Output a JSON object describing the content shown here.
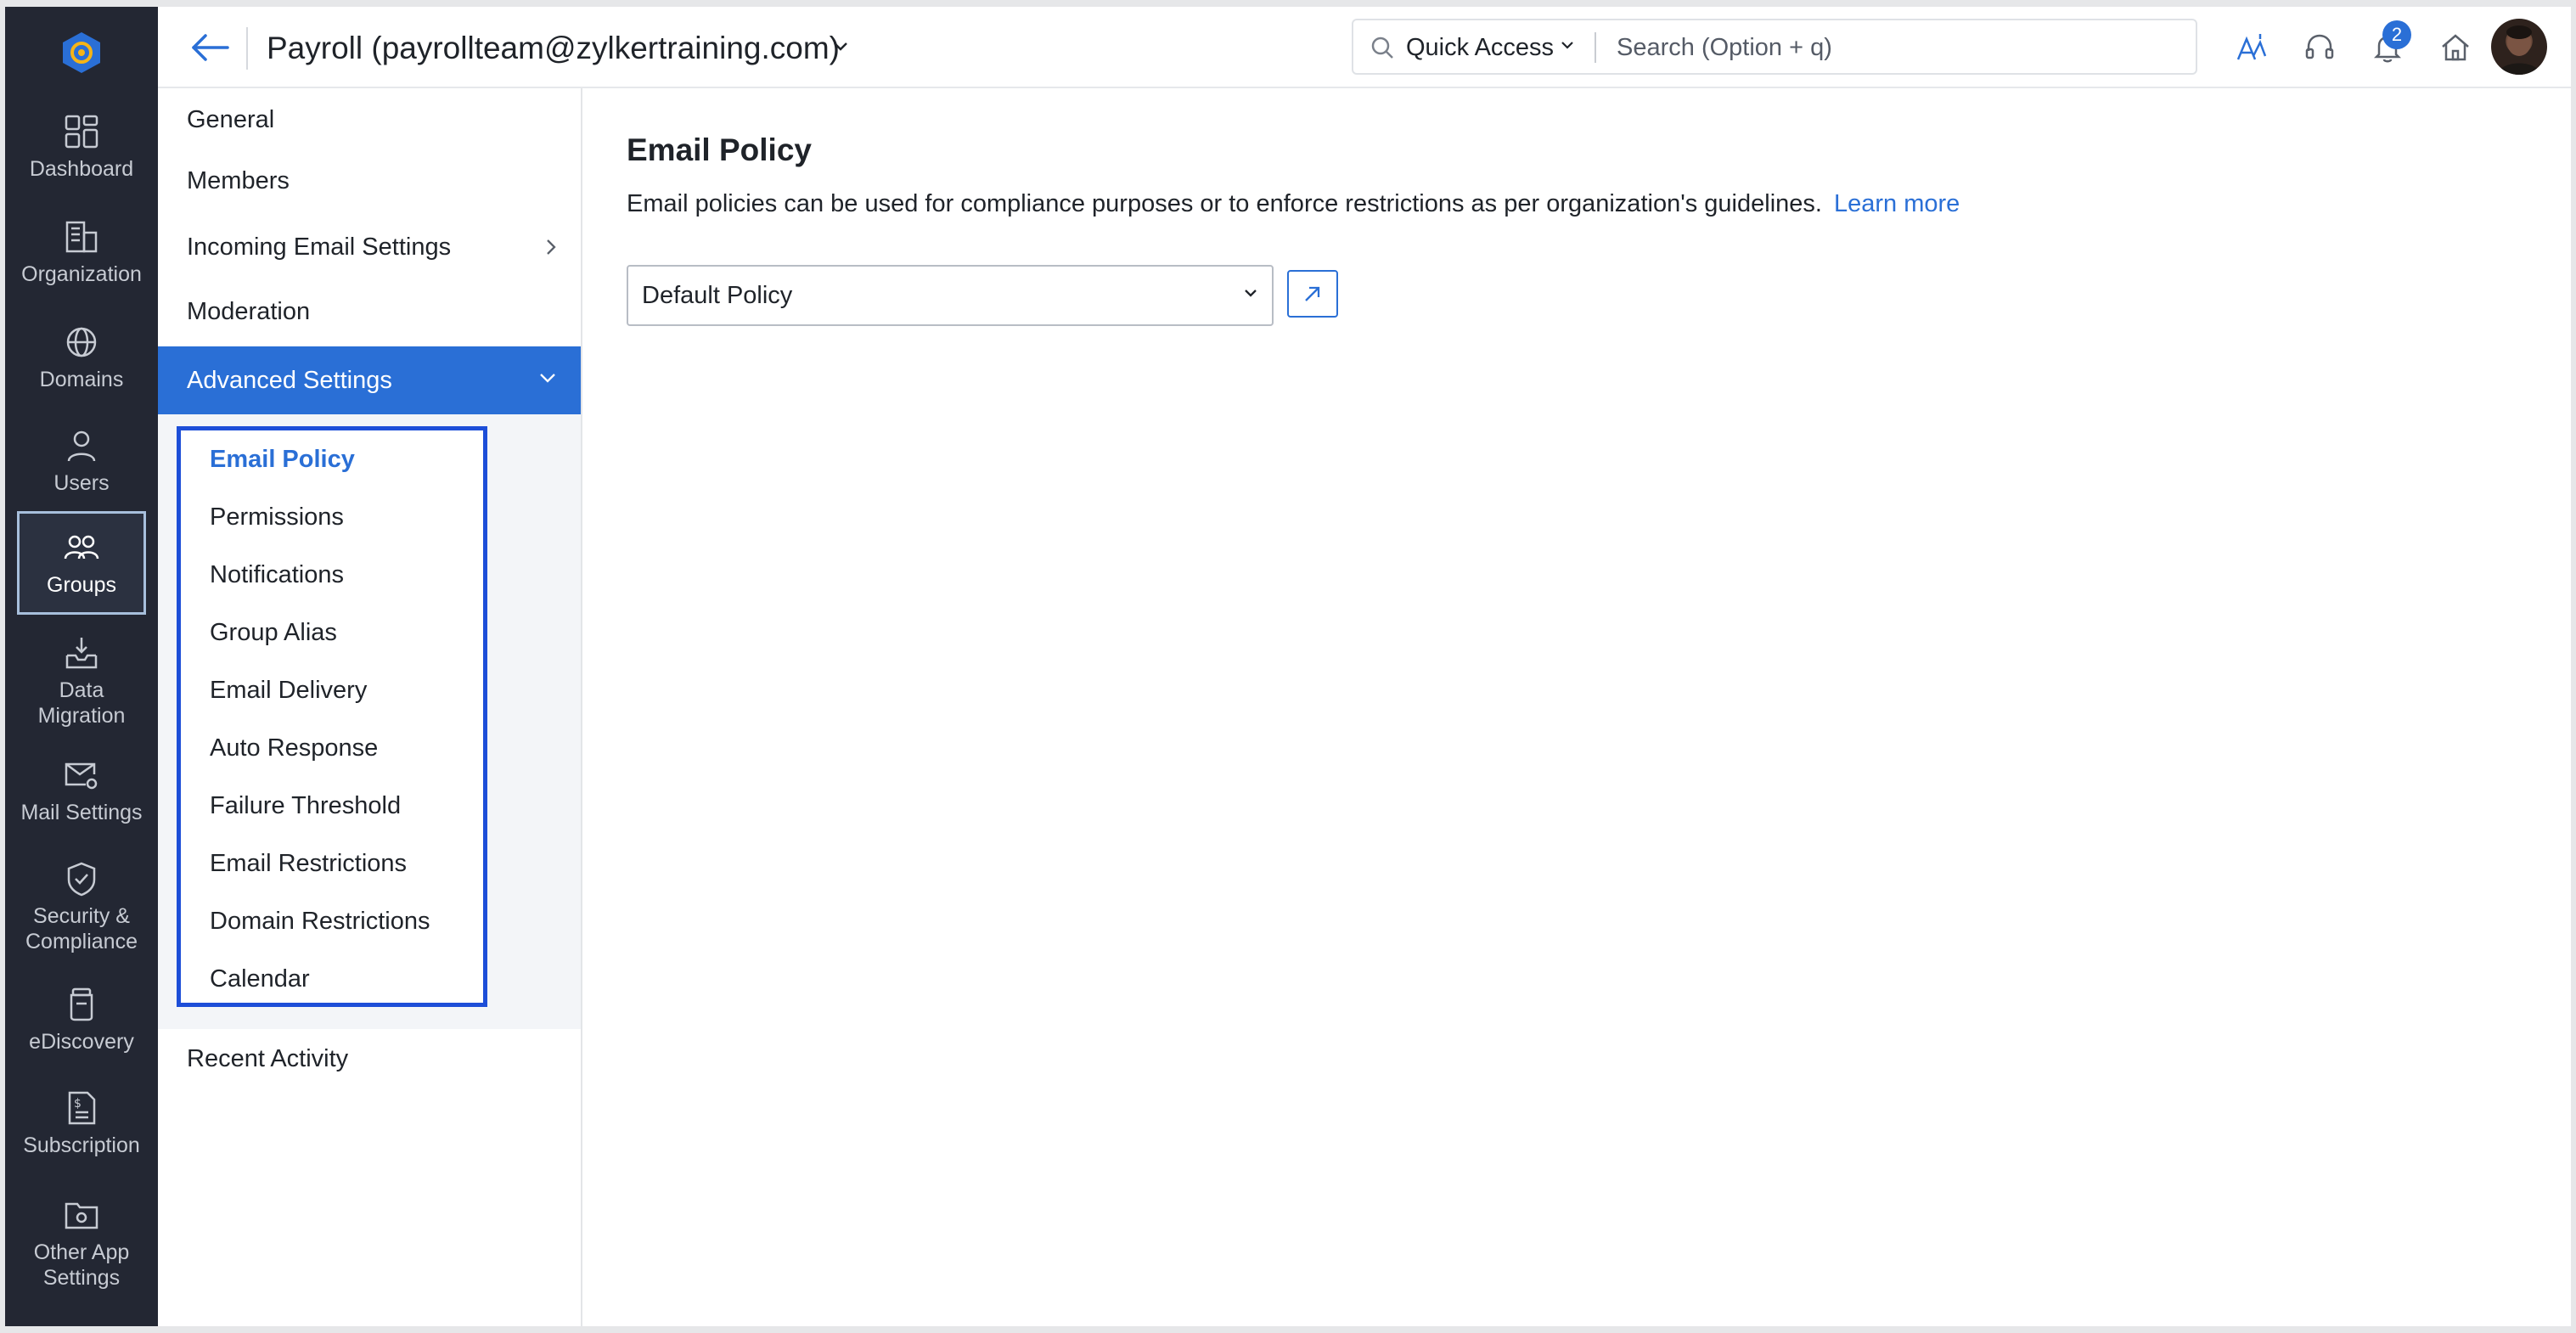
{
  "rail": {
    "items": [
      {
        "label": "Dashboard",
        "icon": "dashboard-icon"
      },
      {
        "label": "Organization",
        "icon": "building-icon"
      },
      {
        "label": "Domains",
        "icon": "globe-icon"
      },
      {
        "label": "Users",
        "icon": "user-icon"
      },
      {
        "label": "Groups",
        "icon": "groups-icon",
        "active": true
      },
      {
        "label": "Data\nMigration",
        "icon": "inbox-download-icon"
      },
      {
        "label": "Mail Settings",
        "icon": "mail-gear-icon"
      },
      {
        "label": "Security &\nCompliance",
        "icon": "shield-check-icon"
      },
      {
        "label": "eDiscovery",
        "icon": "archive-jar-icon"
      },
      {
        "label": "Subscription",
        "icon": "invoice-icon"
      },
      {
        "label": "Other App\nSettings",
        "icon": "folder-gear-icon"
      }
    ]
  },
  "header": {
    "org_title": "Payroll (payrollteam@zylkertraining.com)",
    "quick_access": "Quick Access",
    "search_placeholder": "Search (Option + q)",
    "notification_count": "2"
  },
  "subnav": {
    "general": "General",
    "members": "Members",
    "incoming": "Incoming Email Settings",
    "moderation": "Moderation",
    "advanced": "Advanced Settings",
    "advanced_items": [
      "Email Policy",
      "Permissions",
      "Notifications",
      "Group Alias",
      "Email Delivery",
      "Auto Response",
      "Failure Threshold",
      "Email Restrictions",
      "Domain Restrictions",
      "Calendar"
    ],
    "selected_item": "Email Policy",
    "recent_activity": "Recent Activity"
  },
  "main": {
    "title": "Email Policy",
    "description": "Email policies can be used for compliance purposes or to enforce restrictions as per organization's guidelines.",
    "learn_more": "Learn more",
    "policy_select_value": "Default Policy"
  },
  "colors": {
    "rail_bg": "#232733",
    "accent": "#2a6fd6",
    "highlight_box": "#1d4ed8"
  }
}
